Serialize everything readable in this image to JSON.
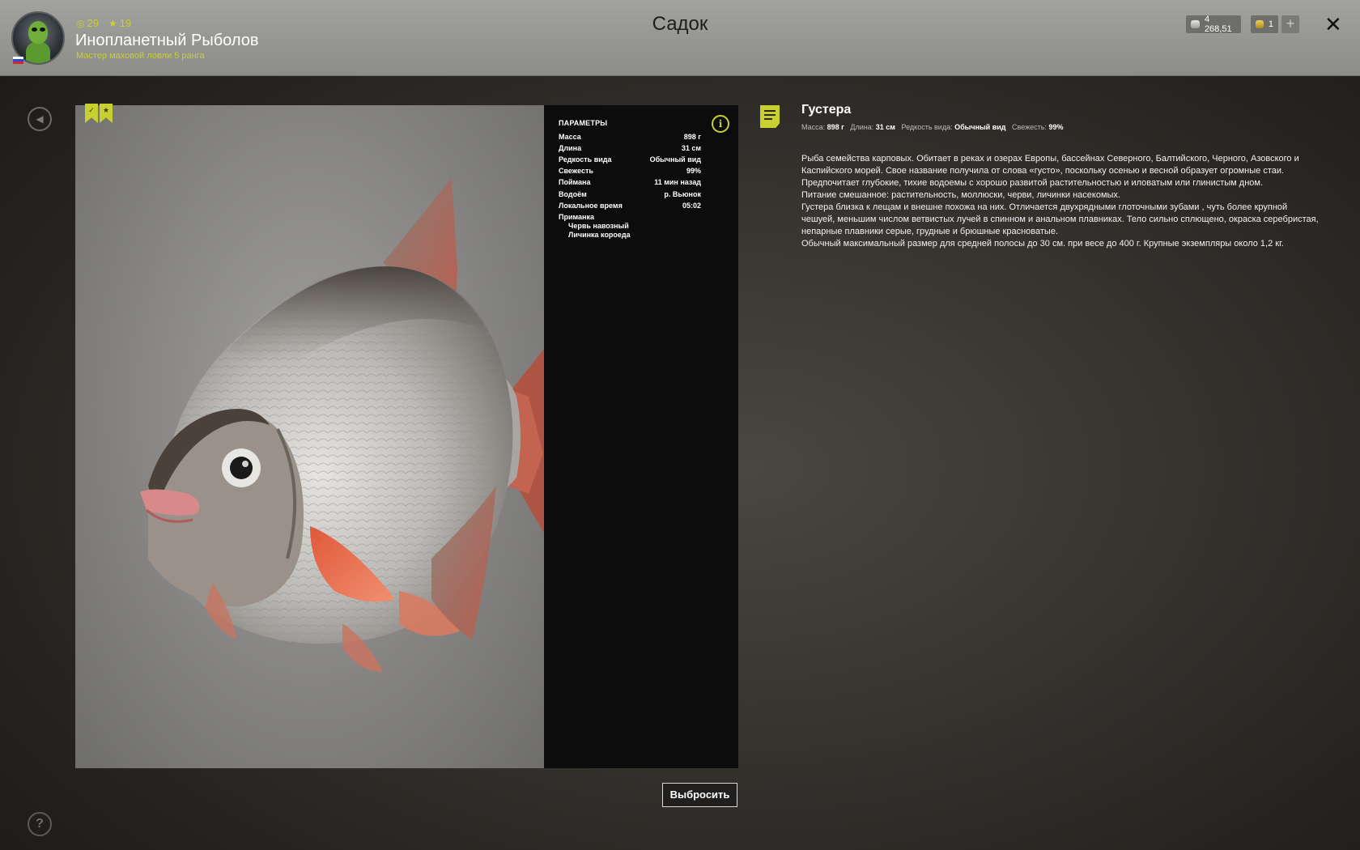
{
  "header": {
    "title": "Садок",
    "player": {
      "name": "Инопланетный Рыболов",
      "rank": "Мастер маховой ловли 5 ранга",
      "level": "29",
      "stars": "19"
    },
    "currency": {
      "silver": "4 268,51",
      "gold": "1",
      "add_label": "+"
    },
    "close_label": "✕"
  },
  "sidebar": {
    "back_label": "◀",
    "help_label": "?"
  },
  "params": {
    "title": "ПАРАМЕТРЫ",
    "rows": [
      {
        "key": "Масса",
        "value": "898 г"
      },
      {
        "key": "Длина",
        "value": "31 см"
      },
      {
        "key": "Редкость вида",
        "value": "Обычный вид"
      },
      {
        "key": "Свежесть",
        "value": "99%"
      },
      {
        "key": "Поймана",
        "value": "11 мин назад"
      },
      {
        "key": "Водоём",
        "value": "р. Вьюнок"
      },
      {
        "key": "Локальное время",
        "value": "05:02"
      }
    ],
    "bait_title": "Приманка",
    "baits": [
      "Червь навозный",
      "Личинка короеда"
    ]
  },
  "fish": {
    "name": "Густера",
    "summary": [
      {
        "label": "Масса:",
        "value": "898 г"
      },
      {
        "label": "Длина:",
        "value": "31 см"
      },
      {
        "label": "Редкость вида:",
        "value": "Обычный вид"
      },
      {
        "label": "Свежесть:",
        "value": "99%"
      }
    ],
    "description": [
      "Рыба семейства карповых. Обитает в реках и озерах Европы, бассейнах Северного, Балтийского, Черного, Азовского и Каспийского морей. Свое название получила от слова «густо», поскольку осенью и весной образует огромные стаи.",
      "Предпочитает глубокие, тихие водоемы с хорошо развитой растительностью и иловатым или глинистым дном.",
      "Питание смешанное: растительность, моллюски, черви, личинки насекомых.",
      "Густера близка к лещам и внешне похожа на них. Отличается двухрядными глоточными зубами , чуть более крупной чешуей, меньшим числом ветвистых лучей в спинном и анальном плавниках. Тело сильно сплющено, окраска серебристая, непарные плавники серые, грудные и брюшные красноватые.",
      "Обычный максимальный размер для средней полосы до 30 см. при весе до 400 г. Крупные экземпляры около 1,2 кг."
    ]
  },
  "actions": {
    "release_label": "Выбросить"
  },
  "colors": {
    "accent": "#c8d030",
    "panel": "#0c0c0c",
    "header": "#969692"
  }
}
